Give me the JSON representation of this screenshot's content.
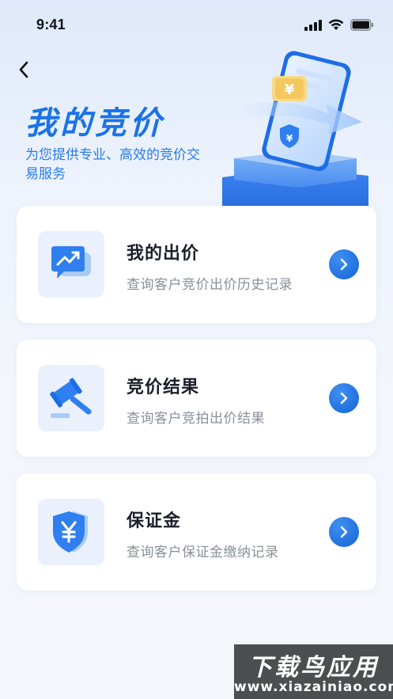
{
  "status_bar": {
    "time": "9:41"
  },
  "header": {
    "title": "我的竞价",
    "subtitle": "为您提供专业、高效的竞价交易服务"
  },
  "cards": [
    {
      "title": "我的出价",
      "desc": "查询客户竞价出价历史记录",
      "icon": "chart-chat-icon"
    },
    {
      "title": "竞价结果",
      "desc": "查询客户竞拍出价结果",
      "icon": "gavel-icon"
    },
    {
      "title": "保证金",
      "desc": "查询客户保证金缴纳记录",
      "icon": "yuan-shield-icon"
    }
  ],
  "watermark": {
    "line1": "下载鸟应用",
    "line2": "www.xiazainiao.com"
  },
  "colors": {
    "accent": "#1a73e8",
    "card_icon_bg": "#eaf1fd",
    "arrow_button": "#1464d6"
  }
}
